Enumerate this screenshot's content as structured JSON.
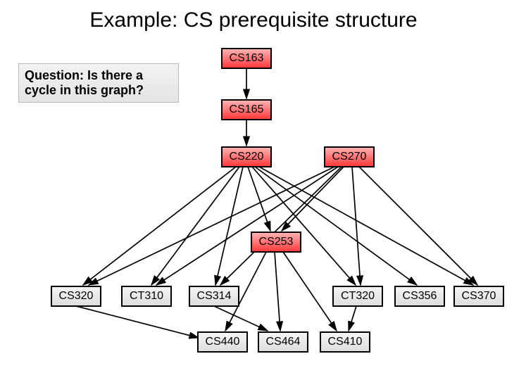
{
  "title": "Example: CS prerequisite structure",
  "question": "Question: Is there a cycle in this graph?",
  "nodes": {
    "cs163": "CS163",
    "cs165": "CS165",
    "cs220": "CS220",
    "cs270": "CS270",
    "cs253": "CS253",
    "cs320": "CS320",
    "ct310": "CT310",
    "cs314": "CS314",
    "ct320": "CT320",
    "cs356": "CS356",
    "cs370": "CS370",
    "cs440": "CS440",
    "cs464": "CS464",
    "cs410": "CS410"
  },
  "chart_data": {
    "type": "directed-graph",
    "title": "CS prerequisite structure",
    "edges": [
      [
        "CS163",
        "CS165"
      ],
      [
        "CS165",
        "CS220"
      ],
      [
        "CS220",
        "CS320"
      ],
      [
        "CS220",
        "CT310"
      ],
      [
        "CS220",
        "CS314"
      ],
      [
        "CS220",
        "CS253"
      ],
      [
        "CS220",
        "CT320"
      ],
      [
        "CS220",
        "CS356"
      ],
      [
        "CS220",
        "CS370"
      ],
      [
        "CS270",
        "CS320"
      ],
      [
        "CS270",
        "CT310"
      ],
      [
        "CS270",
        "CS314"
      ],
      [
        "CS270",
        "CS253"
      ],
      [
        "CS270",
        "CT320"
      ],
      [
        "CS270",
        "CS370"
      ],
      [
        "CS253",
        "CS440"
      ],
      [
        "CS253",
        "CS464"
      ],
      [
        "CS253",
        "CS410"
      ],
      [
        "CS320",
        "CS440"
      ],
      [
        "CS314",
        "CS464"
      ],
      [
        "CT320",
        "CS410"
      ]
    ]
  }
}
